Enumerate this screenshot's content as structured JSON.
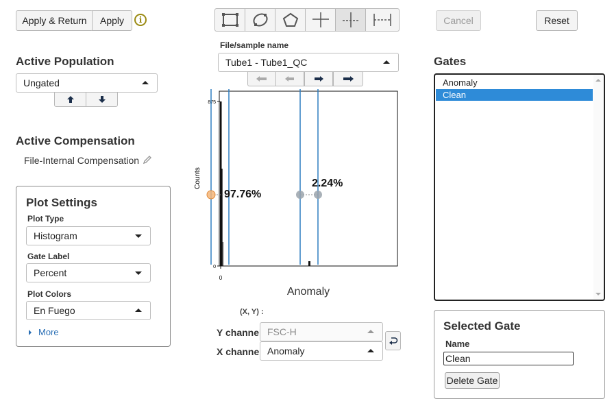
{
  "header": {
    "apply_return_label": "Apply & Return",
    "apply_label": "Apply",
    "cancel_label": "Cancel",
    "reset_label": "Reset"
  },
  "toolbar": {
    "tools": [
      "rectangle-gate-icon",
      "ellipse-gate-icon",
      "polygon-gate-icon",
      "quadrant-gate-icon",
      "vertical-split-gate-icon",
      "range-gate-icon"
    ],
    "active_tool": "vertical-split-gate-icon"
  },
  "active_population": {
    "heading": "Active Population",
    "selected": "Ungated"
  },
  "active_compensation": {
    "heading": "Active Compensation",
    "value": "File-Internal Compensation"
  },
  "plot_settings": {
    "heading": "Plot Settings",
    "plot_type_label": "Plot Type",
    "plot_type": "Histogram",
    "gate_label_label": "Gate Label",
    "gate_label": "Percent",
    "plot_colors_label": "Plot Colors",
    "plot_colors": "En Fuego",
    "more_label": "More"
  },
  "sample": {
    "label": "File/sample name",
    "selected": "Tube1 - Tube1_QC"
  },
  "plot": {
    "y_axis_label": "Counts",
    "x_axis_label": "Anomaly",
    "y_tick_top": "875",
    "y_tick_bottom": "0",
    "x_tick_zero": "0",
    "gate_left_percent": "97.76%",
    "gate_right_percent": "2.24%",
    "accent_color": "#2f7fc1",
    "handle_active_color": "#f4b67a",
    "handle_color": "#9aa3ab"
  },
  "channels": {
    "xy_readout": "(X, Y) :",
    "y_label": "Y channel",
    "y_value": "FSC-H",
    "x_label": "X channel",
    "x_value": "Anomaly"
  },
  "gates": {
    "heading": "Gates",
    "items": [
      "Anomaly",
      "Clean"
    ],
    "selected_index": 1,
    "selection_color": "#2e8bd8"
  },
  "selected_gate": {
    "heading": "Selected Gate",
    "name_label": "Name",
    "name_value": "Clean",
    "delete_label": "Delete Gate"
  }
}
